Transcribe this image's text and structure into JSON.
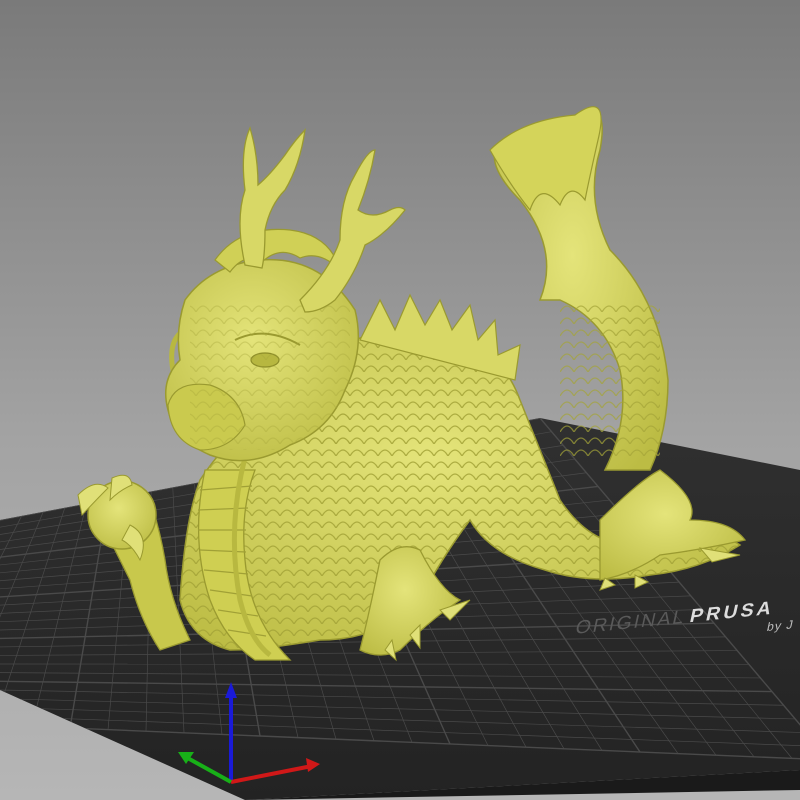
{
  "viewport": {
    "background_top": "#7a7a7a",
    "background_bottom": "#b6b6b6"
  },
  "bed": {
    "surface_color": "#2a2a2a",
    "grid_color": "#4a4a4a",
    "logo_prefix": "ORIGINAL",
    "logo_brand": "PRUSA",
    "logo_suffix": "by J"
  },
  "model": {
    "icon": "dragon-model",
    "color": "#d6d660",
    "shade_color": "#a9a93a"
  },
  "axes": {
    "x_color": "#d01818",
    "y_color": "#18b018",
    "z_color": "#1a1ad8"
  }
}
